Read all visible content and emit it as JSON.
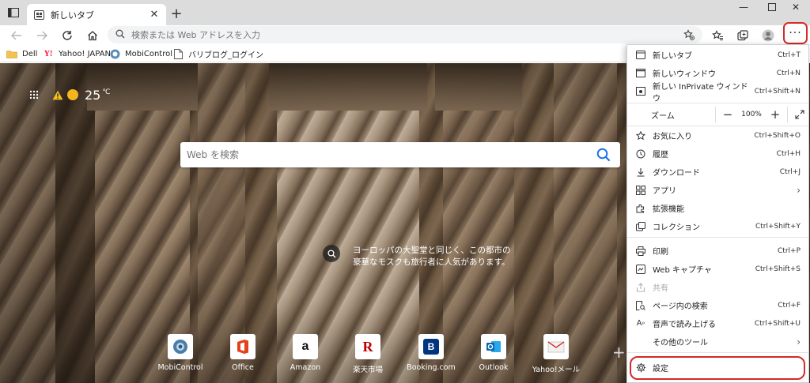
{
  "tab": {
    "title": "新しいタブ"
  },
  "address": {
    "placeholder": "検索または Web アドレスを入力"
  },
  "favorites": [
    {
      "label": "Dell"
    },
    {
      "label": "Yahoo! JAPAN"
    },
    {
      "label": "MobiControl"
    },
    {
      "label": "バリブログ_ログイン"
    }
  ],
  "weather": {
    "temperature": "25",
    "unit": "℃"
  },
  "search": {
    "placeholder": "Web を検索"
  },
  "caption": {
    "text": "ヨーロッパの大聖堂と同じく、この都市の豪華なモスクも旅行者に人気があります。"
  },
  "quick_links": [
    {
      "label": "MobiControl"
    },
    {
      "label": "Office"
    },
    {
      "label": "Amazon"
    },
    {
      "label": "楽天市場"
    },
    {
      "label": "Booking.com"
    },
    {
      "label": "Outlook"
    },
    {
      "label": "Yahoo!メール"
    }
  ],
  "menu": {
    "new_tab": {
      "label": "新しいタブ",
      "shortcut": "Ctrl+T"
    },
    "new_window": {
      "label": "新しいウィンドウ",
      "shortcut": "Ctrl+N"
    },
    "new_private": {
      "label": "新しい InPrivate ウィンドウ",
      "shortcut": "Ctrl+Shift+N"
    },
    "zoom": {
      "label": "ズーム",
      "value": "100%"
    },
    "favorites": {
      "label": "お気に入り",
      "shortcut": "Ctrl+Shift+O"
    },
    "history": {
      "label": "履歴",
      "shortcut": "Ctrl+H"
    },
    "downloads": {
      "label": "ダウンロード",
      "shortcut": "Ctrl+J"
    },
    "apps": {
      "label": "アプリ"
    },
    "extensions": {
      "label": "拡張機能"
    },
    "collections": {
      "label": "コレクション",
      "shortcut": "Ctrl+Shift+Y"
    },
    "print": {
      "label": "印刷",
      "shortcut": "Ctrl+P"
    },
    "web_capture": {
      "label": "Web キャプチャ",
      "shortcut": "Ctrl+Shift+S"
    },
    "share": {
      "label": "共有"
    },
    "find": {
      "label": "ページ内の検索",
      "shortcut": "Ctrl+F"
    },
    "read_aloud": {
      "label": "音声で読み上げる",
      "shortcut": "Ctrl+Shift+U"
    },
    "more_tools": {
      "label": "その他のツール"
    },
    "settings": {
      "label": "設定"
    }
  },
  "colors": {
    "highlight": "#d42a2a",
    "search_icon": "#1a73e8"
  }
}
